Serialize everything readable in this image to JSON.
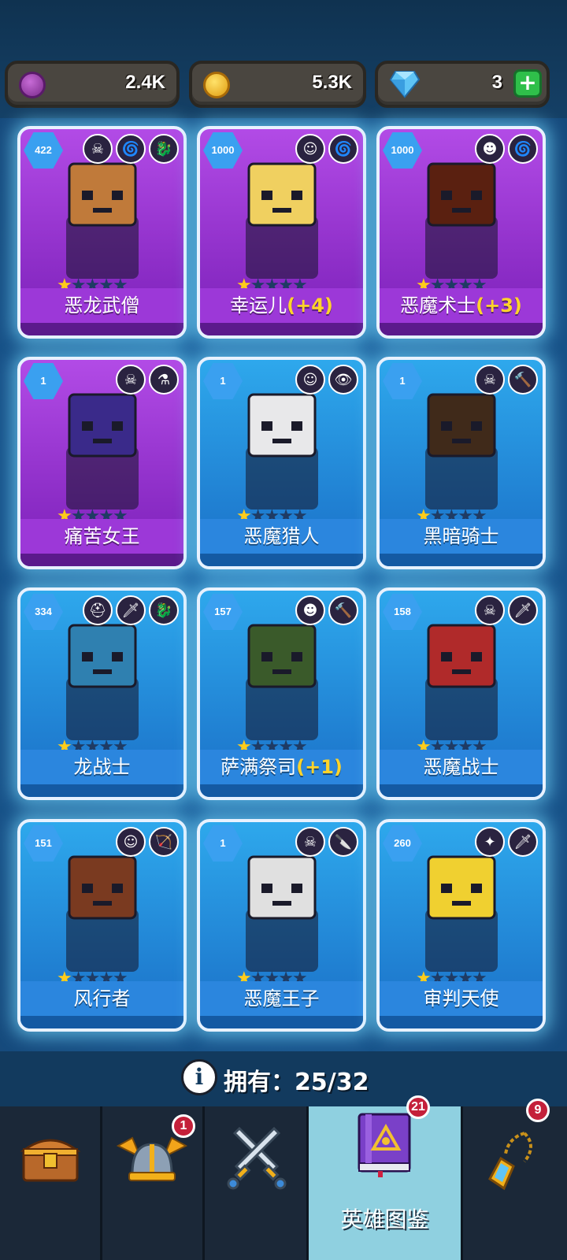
{
  "resources": [
    {
      "name": "purple-gem",
      "value": "2.4K",
      "color": "#9b3fa8"
    },
    {
      "name": "gold-coin",
      "value": "5.3K",
      "color": "#f2b316"
    },
    {
      "name": "diamond",
      "value": "3",
      "color": "#4fb4ef",
      "plus": "+"
    }
  ],
  "cards": [
    {
      "name": "恶龙武僧",
      "level": "422",
      "bonus": "",
      "stars": 1,
      "theme": "purple",
      "icons": [
        "skull-icon",
        "spiral-icon",
        "dragon-icon"
      ],
      "art": "#c07a3a"
    },
    {
      "name": "幸运儿",
      "level": "1000",
      "bonus": "(+4)",
      "stars": 1,
      "theme": "purple",
      "icons": [
        "elf-icon",
        "spiral-icon"
      ],
      "art": "#f0d060"
    },
    {
      "name": "恶魔术士",
      "level": "1000",
      "bonus": "(+3)",
      "stars": 1,
      "theme": "purple",
      "icons": [
        "orc-icon",
        "spiral-icon"
      ],
      "art": "#5a2010"
    },
    {
      "name": "痛苦女王",
      "level": "1",
      "bonus": "",
      "stars": 1,
      "theme": "purple",
      "icons": [
        "skull-icon",
        "potion-icon"
      ],
      "art": "#3a2a8a"
    },
    {
      "name": "恶魔猎人",
      "level": "1",
      "bonus": "",
      "stars": 1,
      "theme": "blue",
      "icons": [
        "elf-icon",
        "eye-icon"
      ],
      "art": "#e8e8ea"
    },
    {
      "name": "黑暗骑士",
      "level": "1",
      "bonus": "",
      "stars": 1,
      "theme": "blue",
      "icons": [
        "skull-icon",
        "hammer-icon"
      ],
      "art": "#402a1a"
    },
    {
      "name": "龙战士",
      "level": "334",
      "bonus": "",
      "stars": 1,
      "theme": "blue",
      "icons": [
        "helmet-icon",
        "sword-icon",
        "dragon-icon"
      ],
      "art": "#2f80b0"
    },
    {
      "name": "萨满祭司",
      "level": "157",
      "bonus": "(+1)",
      "stars": 1,
      "theme": "blue",
      "icons": [
        "orc-icon",
        "hammer-icon"
      ],
      "art": "#3a5a2a"
    },
    {
      "name": "恶魔战士",
      "level": "158",
      "bonus": "",
      "stars": 1,
      "theme": "blue",
      "icons": [
        "skull-icon",
        "sword-icon"
      ],
      "art": "#b02a2a"
    },
    {
      "name": "风行者",
      "level": "151",
      "bonus": "",
      "stars": 1,
      "theme": "blue",
      "icons": [
        "elf-icon",
        "bow-icon"
      ],
      "art": "#7a3a20"
    },
    {
      "name": "恶魔王子",
      "level": "1",
      "bonus": "",
      "stars": 1,
      "theme": "blue",
      "icons": [
        "skull-icon",
        "dagger-icon"
      ],
      "art": "#e0e0e0"
    },
    {
      "name": "审判天使",
      "level": "260",
      "bonus": "",
      "stars": 1,
      "theme": "blue",
      "icons": [
        "wings-icon",
        "sword-icon"
      ],
      "art": "#f0d030"
    }
  ],
  "owned": {
    "label": "拥有：",
    "count": "25/32"
  },
  "nav": {
    "tabs": [
      {
        "name": "chest",
        "badge": ""
      },
      {
        "name": "helmet",
        "badge": "1"
      },
      {
        "name": "battle",
        "badge": ""
      },
      {
        "name": "hero-book",
        "badge": "21",
        "label": "英雄图鉴",
        "active": true
      },
      {
        "name": "amulet",
        "badge": "9"
      }
    ]
  }
}
